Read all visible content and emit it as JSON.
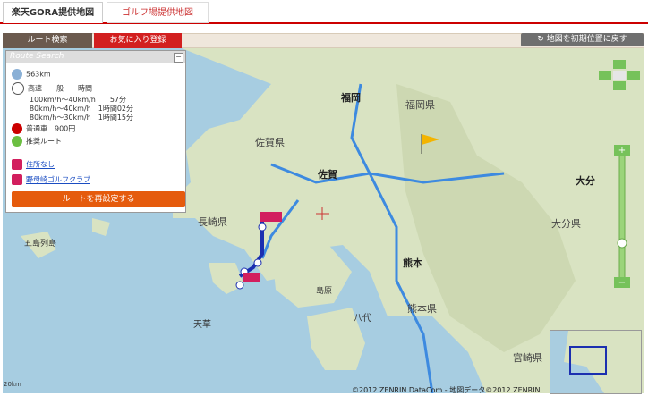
{
  "tabs": {
    "active": "楽天GORA提供地図",
    "inactive": "ゴルフ場提供地図"
  },
  "subtabs": {
    "route": "ルート検索",
    "favorite": "お気に入り登録"
  },
  "reset_view": "地図を初期位置に戻す",
  "panel": {
    "header": "Route Search",
    "distance": "563km",
    "speed_header": [
      "高速",
      "一般",
      "時間"
    ],
    "speed_rows": [
      "100km/h〜40km/h　　57分",
      "80km/h〜40km/h　1時間02分",
      "80km/h〜30km/h　1時間15分"
    ],
    "toll": "普通車　900円",
    "recommended": "推奨ルート",
    "start_label": "住所なし",
    "goal_label": "野母崎ゴルフクラブ",
    "reset_route": "ルートを再設定する"
  },
  "map_labels": {
    "fukuoka": "福岡",
    "fukuoka_pref": "福岡県",
    "saga_pref": "佐賀県",
    "saga": "佐賀",
    "nagasaki_pref": "長崎県",
    "kumamoto": "熊本",
    "kumamoto_pref": "熊本県",
    "oita_pref": "大分県",
    "oita": "大分",
    "miyazaki_pref": "宮崎県",
    "amakusa": "天草",
    "shimabara": "島原",
    "goto": "五島列島",
    "yatsushiro": "八代"
  },
  "copyright": "©2012 ZENRIN DataCom - 地図データ©2012 ZENRIN",
  "scale": "20km"
}
